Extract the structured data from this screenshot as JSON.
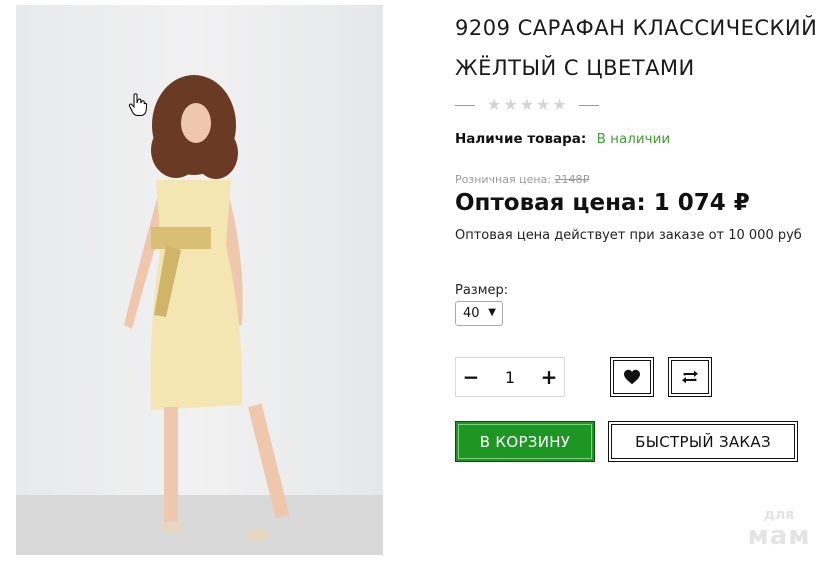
{
  "product": {
    "title_line1": "9209 САРАФАН КЛАССИЧЕСКИЙ",
    "title_line2": "ЖЁЛТЫЙ С ЦВЕТАМИ",
    "rating": {
      "stars_filled": 0,
      "stars_total": 5
    },
    "availability_label": "Наличие товара:",
    "availability_value": "В наличии",
    "retail_label": "Розничная цена:",
    "retail_price": "2148₽",
    "wholesale_label": "Оптовая цена:",
    "wholesale_price": "1 074 ₽",
    "wholesale_note": "Оптовая цена действует при заказе от 10 000 руб"
  },
  "size": {
    "label": "Размер:",
    "selected": "40"
  },
  "quantity": {
    "minus": "−",
    "value": "1",
    "plus": "+"
  },
  "actions": {
    "wishlist_icon": "heart-icon",
    "compare_icon": "compare-icon",
    "add_to_cart": "В КОРЗИНУ",
    "quick_order": "БЫСТРЫЙ ЗАКАЗ"
  },
  "watermark": {
    "line1": "для",
    "line2": "мам"
  },
  "colors": {
    "accent_green": "#1d9624",
    "in_stock_green": "#3f9f2e",
    "star_grey": "#d4d4d4"
  }
}
